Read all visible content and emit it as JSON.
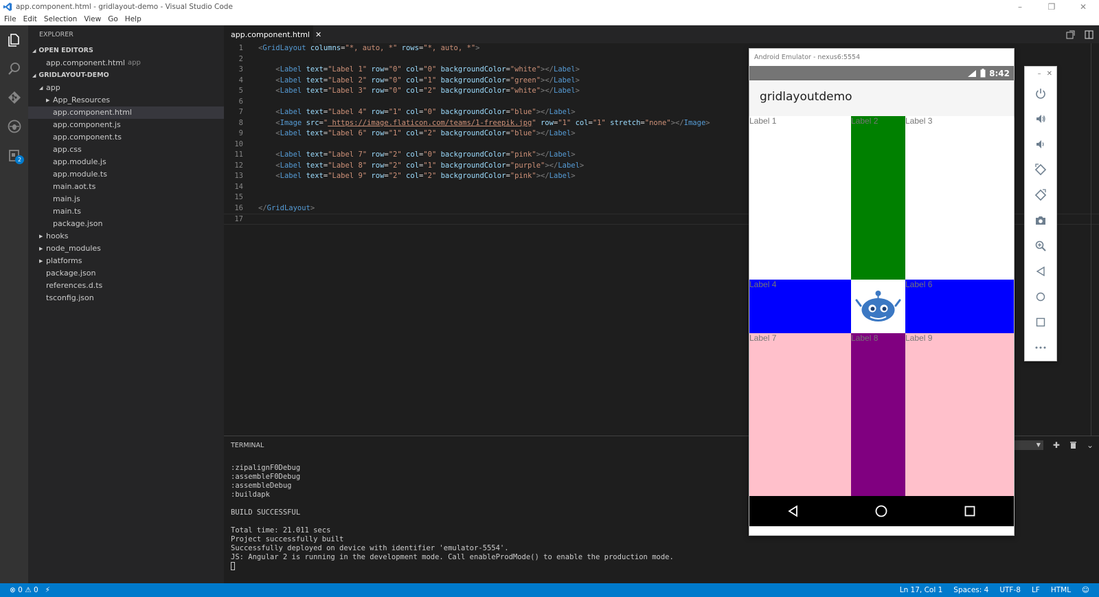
{
  "window": {
    "title": "app.component.html - gridlayout-demo - Visual Studio Code",
    "controls": [
      "–",
      "❐",
      "✕"
    ]
  },
  "menu": [
    "File",
    "Edit",
    "Selection",
    "View",
    "Go",
    "Help"
  ],
  "activity_badge": "2",
  "sidebar": {
    "title": "EXPLORER",
    "open_editors_header": "OPEN EDITORS",
    "open_editor": {
      "name": "app.component.html",
      "hint": "app"
    },
    "project_header": "GRIDLAYOUT-DEMO",
    "tree": [
      {
        "label": "app",
        "depth": 1,
        "type": "folder-open"
      },
      {
        "label": "App_Resources",
        "depth": 2,
        "type": "folder"
      },
      {
        "label": "app.component.html",
        "depth": 2,
        "type": "file",
        "selected": true
      },
      {
        "label": "app.component.js",
        "depth": 2,
        "type": "file"
      },
      {
        "label": "app.component.ts",
        "depth": 2,
        "type": "file"
      },
      {
        "label": "app.css",
        "depth": 2,
        "type": "file"
      },
      {
        "label": "app.module.js",
        "depth": 2,
        "type": "file"
      },
      {
        "label": "app.module.ts",
        "depth": 2,
        "type": "file"
      },
      {
        "label": "main.aot.ts",
        "depth": 2,
        "type": "file"
      },
      {
        "label": "main.js",
        "depth": 2,
        "type": "file"
      },
      {
        "label": "main.ts",
        "depth": 2,
        "type": "file"
      },
      {
        "label": "package.json",
        "depth": 2,
        "type": "file"
      },
      {
        "label": "hooks",
        "depth": 1,
        "type": "folder"
      },
      {
        "label": "node_modules",
        "depth": 1,
        "type": "folder"
      },
      {
        "label": "platforms",
        "depth": 1,
        "type": "folder"
      },
      {
        "label": "package.json",
        "depth": 1,
        "type": "file"
      },
      {
        "label": "references.d.ts",
        "depth": 1,
        "type": "file"
      },
      {
        "label": "tsconfig.json",
        "depth": 1,
        "type": "file"
      }
    ]
  },
  "tab": {
    "label": "app.component.html",
    "close": "✕"
  },
  "editor": {
    "lines": [
      [
        [
          "br",
          "<"
        ],
        [
          "tag",
          "GridLayout"
        ],
        [
          "sp",
          " "
        ],
        [
          "attr",
          "columns"
        ],
        [
          "eq",
          "="
        ],
        [
          "str",
          "\"*, auto, *\""
        ],
        [
          "sp",
          " "
        ],
        [
          "attr",
          "rows"
        ],
        [
          "eq",
          "="
        ],
        [
          "str",
          "\"*, auto, *\""
        ],
        [
          "br",
          ">"
        ]
      ],
      [],
      [
        [
          "sp",
          "    "
        ],
        [
          "br",
          "<"
        ],
        [
          "tag",
          "Label"
        ],
        [
          "sp",
          " "
        ],
        [
          "attr",
          "text"
        ],
        [
          "eq",
          "="
        ],
        [
          "str",
          "\"Label 1\""
        ],
        [
          "sp",
          " "
        ],
        [
          "attr",
          "row"
        ],
        [
          "eq",
          "="
        ],
        [
          "str",
          "\"0\""
        ],
        [
          "sp",
          " "
        ],
        [
          "attr",
          "col"
        ],
        [
          "eq",
          "="
        ],
        [
          "str",
          "\"0\""
        ],
        [
          "sp",
          " "
        ],
        [
          "attr",
          "backgroundColor"
        ],
        [
          "eq",
          "="
        ],
        [
          "str",
          "\"white\""
        ],
        [
          "br",
          "></"
        ],
        [
          "tag",
          "Label"
        ],
        [
          "br",
          ">"
        ]
      ],
      [
        [
          "sp",
          "    "
        ],
        [
          "br",
          "<"
        ],
        [
          "tag",
          "Label"
        ],
        [
          "sp",
          " "
        ],
        [
          "attr",
          "text"
        ],
        [
          "eq",
          "="
        ],
        [
          "str",
          "\"Label 2\""
        ],
        [
          "sp",
          " "
        ],
        [
          "attr",
          "row"
        ],
        [
          "eq",
          "="
        ],
        [
          "str",
          "\"0\""
        ],
        [
          "sp",
          " "
        ],
        [
          "attr",
          "col"
        ],
        [
          "eq",
          "="
        ],
        [
          "str",
          "\"1\""
        ],
        [
          "sp",
          " "
        ],
        [
          "attr",
          "backgroundColor"
        ],
        [
          "eq",
          "="
        ],
        [
          "str",
          "\"green\""
        ],
        [
          "br",
          "></"
        ],
        [
          "tag",
          "Label"
        ],
        [
          "br",
          ">"
        ]
      ],
      [
        [
          "sp",
          "    "
        ],
        [
          "br",
          "<"
        ],
        [
          "tag",
          "Label"
        ],
        [
          "sp",
          " "
        ],
        [
          "attr",
          "text"
        ],
        [
          "eq",
          "="
        ],
        [
          "str",
          "\"Label 3\""
        ],
        [
          "sp",
          " "
        ],
        [
          "attr",
          "row"
        ],
        [
          "eq",
          "="
        ],
        [
          "str",
          "\"0\""
        ],
        [
          "sp",
          " "
        ],
        [
          "attr",
          "col"
        ],
        [
          "eq",
          "="
        ],
        [
          "str",
          "\"2\""
        ],
        [
          "sp",
          " "
        ],
        [
          "attr",
          "backgroundColor"
        ],
        [
          "eq",
          "="
        ],
        [
          "str",
          "\"white\""
        ],
        [
          "br",
          "></"
        ],
        [
          "tag",
          "Label"
        ],
        [
          "br",
          ">"
        ]
      ],
      [],
      [
        [
          "sp",
          "    "
        ],
        [
          "br",
          "<"
        ],
        [
          "tag",
          "Label"
        ],
        [
          "sp",
          " "
        ],
        [
          "attr",
          "text"
        ],
        [
          "eq",
          "="
        ],
        [
          "str",
          "\"Label 4\""
        ],
        [
          "sp",
          " "
        ],
        [
          "attr",
          "row"
        ],
        [
          "eq",
          "="
        ],
        [
          "str",
          "\"1\""
        ],
        [
          "sp",
          " "
        ],
        [
          "attr",
          "col"
        ],
        [
          "eq",
          "="
        ],
        [
          "str",
          "\"0\""
        ],
        [
          "sp",
          " "
        ],
        [
          "attr",
          "backgroundColor"
        ],
        [
          "eq",
          "="
        ],
        [
          "str",
          "\"blue\""
        ],
        [
          "br",
          "></"
        ],
        [
          "tag",
          "Label"
        ],
        [
          "br",
          ">"
        ]
      ],
      [
        [
          "sp",
          "    "
        ],
        [
          "br",
          "<"
        ],
        [
          "tag",
          "Image"
        ],
        [
          "sp",
          " "
        ],
        [
          "attr",
          "src"
        ],
        [
          "eq",
          "="
        ],
        [
          "str",
          "\""
        ],
        [
          "url",
          " https://image.flaticon.com/teams/1-freepik.jpg"
        ],
        [
          "str",
          "\""
        ],
        [
          "sp",
          " "
        ],
        [
          "attr",
          "row"
        ],
        [
          "eq",
          "="
        ],
        [
          "str",
          "\"1\""
        ],
        [
          "sp",
          " "
        ],
        [
          "attr",
          "col"
        ],
        [
          "eq",
          "="
        ],
        [
          "str",
          "\"1\""
        ],
        [
          "sp",
          " "
        ],
        [
          "attr",
          "stretch"
        ],
        [
          "eq",
          "="
        ],
        [
          "str",
          "\"none\""
        ],
        [
          "br",
          "></"
        ],
        [
          "tag",
          "Image"
        ],
        [
          "br",
          ">"
        ]
      ],
      [
        [
          "sp",
          "    "
        ],
        [
          "br",
          "<"
        ],
        [
          "tag",
          "Label"
        ],
        [
          "sp",
          " "
        ],
        [
          "attr",
          "text"
        ],
        [
          "eq",
          "="
        ],
        [
          "str",
          "\"Label 6\""
        ],
        [
          "sp",
          " "
        ],
        [
          "attr",
          "row"
        ],
        [
          "eq",
          "="
        ],
        [
          "str",
          "\"1\""
        ],
        [
          "sp",
          " "
        ],
        [
          "attr",
          "col"
        ],
        [
          "eq",
          "="
        ],
        [
          "str",
          "\"2\""
        ],
        [
          "sp",
          " "
        ],
        [
          "attr",
          "backgroundColor"
        ],
        [
          "eq",
          "="
        ],
        [
          "str",
          "\"blue\""
        ],
        [
          "br",
          "></"
        ],
        [
          "tag",
          "Label"
        ],
        [
          "br",
          ">"
        ]
      ],
      [],
      [
        [
          "sp",
          "    "
        ],
        [
          "br",
          "<"
        ],
        [
          "tag",
          "Label"
        ],
        [
          "sp",
          " "
        ],
        [
          "attr",
          "text"
        ],
        [
          "eq",
          "="
        ],
        [
          "str",
          "\"Label 7\""
        ],
        [
          "sp",
          " "
        ],
        [
          "attr",
          "row"
        ],
        [
          "eq",
          "="
        ],
        [
          "str",
          "\"2\""
        ],
        [
          "sp",
          " "
        ],
        [
          "attr",
          "col"
        ],
        [
          "eq",
          "="
        ],
        [
          "str",
          "\"0\""
        ],
        [
          "sp",
          " "
        ],
        [
          "attr",
          "backgroundColor"
        ],
        [
          "eq",
          "="
        ],
        [
          "str",
          "\"pink\""
        ],
        [
          "br",
          "></"
        ],
        [
          "tag",
          "Label"
        ],
        [
          "br",
          ">"
        ]
      ],
      [
        [
          "sp",
          "    "
        ],
        [
          "br",
          "<"
        ],
        [
          "tag",
          "Label"
        ],
        [
          "sp",
          " "
        ],
        [
          "attr",
          "text"
        ],
        [
          "eq",
          "="
        ],
        [
          "str",
          "\"Label 8\""
        ],
        [
          "sp",
          " "
        ],
        [
          "attr",
          "row"
        ],
        [
          "eq",
          "="
        ],
        [
          "str",
          "\"2\""
        ],
        [
          "sp",
          " "
        ],
        [
          "attr",
          "col"
        ],
        [
          "eq",
          "="
        ],
        [
          "str",
          "\"1\""
        ],
        [
          "sp",
          " "
        ],
        [
          "attr",
          "backgroundColor"
        ],
        [
          "eq",
          "="
        ],
        [
          "str",
          "\"purple\""
        ],
        [
          "br",
          "></"
        ],
        [
          "tag",
          "Label"
        ],
        [
          "br",
          ">"
        ]
      ],
      [
        [
          "sp",
          "    "
        ],
        [
          "br",
          "<"
        ],
        [
          "tag",
          "Label"
        ],
        [
          "sp",
          " "
        ],
        [
          "attr",
          "text"
        ],
        [
          "eq",
          "="
        ],
        [
          "str",
          "\"Label 9\""
        ],
        [
          "sp",
          " "
        ],
        [
          "attr",
          "row"
        ],
        [
          "eq",
          "="
        ],
        [
          "str",
          "\"2\""
        ],
        [
          "sp",
          " "
        ],
        [
          "attr",
          "col"
        ],
        [
          "eq",
          "="
        ],
        [
          "str",
          "\"2\""
        ],
        [
          "sp",
          " "
        ],
        [
          "attr",
          "backgroundColor"
        ],
        [
          "eq",
          "="
        ],
        [
          "str",
          "\"pink\""
        ],
        [
          "br",
          "></"
        ],
        [
          "tag",
          "Label"
        ],
        [
          "br",
          ">"
        ]
      ],
      [],
      [],
      [
        [
          "br",
          "</"
        ],
        [
          "tag",
          "GridLayout"
        ],
        [
          "br",
          ">"
        ]
      ],
      []
    ]
  },
  "terminal": {
    "title": "TERMINAL",
    "lines": [
      ":zipalignF0Debug",
      ":assembleF0Debug",
      ":assembleDebug",
      ":buildapk",
      "",
      "BUILD SUCCESSFUL",
      "",
      "Total time: 21.011 secs",
      "Project successfully built",
      "Successfully deployed on device with identifier 'emulator-5554'.",
      "JS: Angular 2 is running in the development mode. Call enableProdMode() to enable the production mode."
    ]
  },
  "statusbar": {
    "errors": "0",
    "warnings": "0",
    "position": "Ln 17, Col 1",
    "spaces": "Spaces: 4",
    "encoding": "UTF-8",
    "eol": "LF",
    "language": "HTML"
  },
  "emulator": {
    "title": "Android Emulator - nexus6:5554",
    "time": "8:42",
    "app_title": "gridlayoutdemo",
    "cells": [
      {
        "text": "Label 1",
        "color": "#ffffff"
      },
      {
        "text": "Label 2",
        "color": "#008000"
      },
      {
        "text": "Label 3",
        "color": "#ffffff"
      },
      {
        "text": "Label 4",
        "color": "#0000ff"
      },
      {
        "text": "",
        "color": "#ffffff",
        "image": true
      },
      {
        "text": "Label 6",
        "color": "#0000ff"
      },
      {
        "text": "Label 7",
        "color": "#ffc0cb"
      },
      {
        "text": "Label 8",
        "color": "#800080"
      },
      {
        "text": "Label 9",
        "color": "#ffc0cb"
      }
    ],
    "toolbar": [
      "power-icon",
      "volume-up-icon",
      "volume-down-icon",
      "rotate-left-icon",
      "rotate-right-icon",
      "camera-icon",
      "zoom-icon",
      "back-icon",
      "home-icon",
      "overview-icon",
      "more-icon"
    ]
  },
  "colors": {
    "accent": "#007acc",
    "editor_bg": "#1e1e1e",
    "sidebar_bg": "#252526",
    "activity_bg": "#333333"
  }
}
